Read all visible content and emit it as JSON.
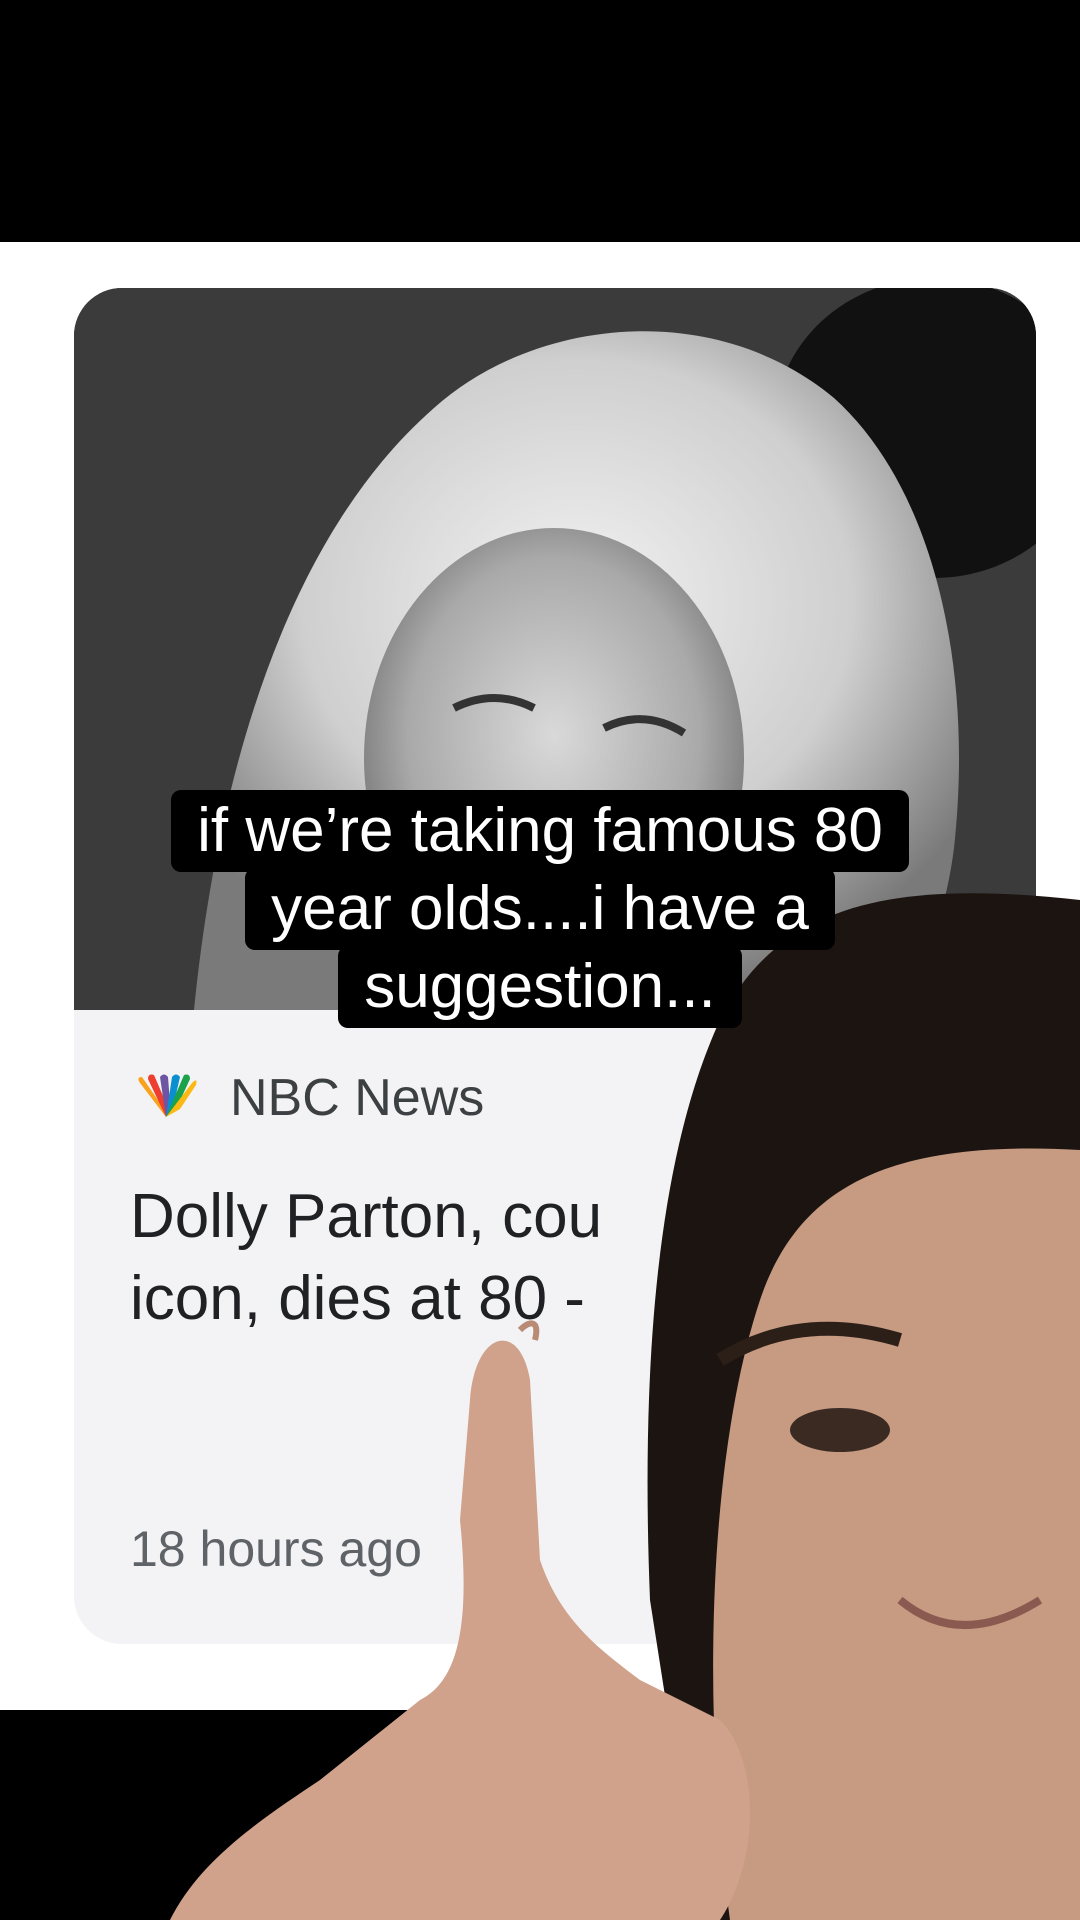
{
  "card": {
    "source": "NBC News",
    "headline_line1": "Dolly Parton, cou",
    "headline_line2": "icon, dies at 80 -",
    "timestamp": "18 hours ago"
  },
  "caption": {
    "line1": "if we’re taking famous 80",
    "line2": "year olds....i have a",
    "line3": "suggestion..."
  },
  "colors": {
    "caption_bg": "#000000",
    "caption_text": "#ffffff",
    "card_bg": "#f3f3f5",
    "headline": "#202124",
    "meta": "#5f6368"
  },
  "icons": {
    "source_logo": "peacock-icon"
  }
}
